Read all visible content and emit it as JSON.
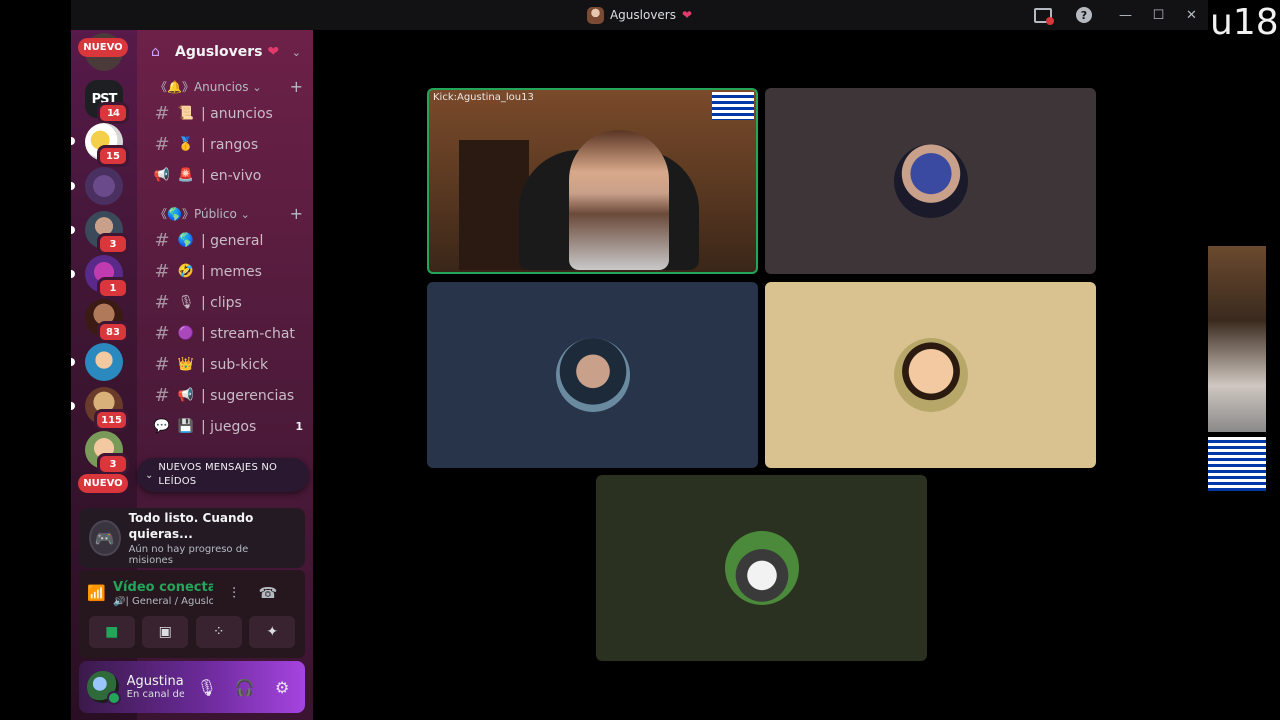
{
  "window": {
    "title": "Aguslovers"
  },
  "watermark": "u18",
  "server_rail": {
    "nuevo_top": "NUEVO",
    "nuevo_bottom": "NUEVO",
    "pst_label": "PST",
    "servers": [
      {
        "badge": "14"
      },
      {
        "badge": "15"
      },
      {
        "badge": ""
      },
      {
        "badge": "3"
      },
      {
        "badge": "1"
      },
      {
        "badge": "83"
      },
      {
        "badge": ""
      },
      {
        "badge": "115"
      },
      {
        "badge": "3"
      }
    ]
  },
  "guild": {
    "name": "Aguslovers",
    "categories": [
      {
        "label": "《🔔》Anuncios",
        "channels": [
          {
            "icon": "#",
            "emoji": "📜",
            "name": "| anuncios",
            "count": ""
          },
          {
            "icon": "#",
            "emoji": "🥇",
            "name": "| rangos",
            "count": ""
          },
          {
            "icon": "📢",
            "emoji": "🚨",
            "name": "| en-vivo",
            "count": ""
          }
        ]
      },
      {
        "label": "《🌎》Público",
        "channels": [
          {
            "icon": "#",
            "emoji": "🌎",
            "name": "| general",
            "count": ""
          },
          {
            "icon": "#",
            "emoji": "🤣",
            "name": "| memes",
            "count": ""
          },
          {
            "icon": "#",
            "emoji": "🎙",
            "name": "| clips",
            "count": ""
          },
          {
            "icon": "#",
            "emoji": "🟣",
            "name": "| stream-chat",
            "count": ""
          },
          {
            "icon": "#",
            "emoji": "👑",
            "name": "| sub-kick",
            "count": ""
          },
          {
            "icon": "#",
            "emoji": "📢",
            "name": "| sugerencias",
            "count": ""
          },
          {
            "icon": "💬",
            "emoji": "💾",
            "name": "| juegos",
            "count": "1"
          }
        ]
      }
    ],
    "unread_banner": "NUEVOS MENSAJES NO LEÍDOS"
  },
  "quest": {
    "title": "Todo listo. Cuando quieras...",
    "subtitle": "Aún no hay progreso de misiones"
  },
  "voice": {
    "status": "Vídeo conectado",
    "channel": "🔊| General / Aguslovers"
  },
  "user": {
    "name": "Agustina",
    "status": "En canal de voz"
  },
  "video": {
    "cam_overlay": "Kick:Agustina_lou13",
    "tiles": [
      "agus",
      "p2",
      "p3",
      "p4",
      "p5"
    ]
  },
  "colors": {
    "accent_green": "#23a55a",
    "badge_red": "#da373c",
    "tile_2": "#3e3539",
    "tile_3": "#27344a",
    "tile_4": "#d9c28f",
    "tile_5": "#2b3120"
  }
}
